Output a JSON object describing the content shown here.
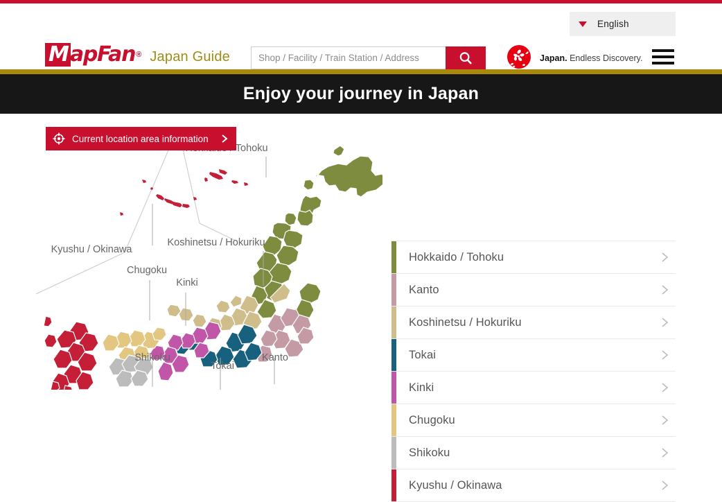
{
  "top_accent_color": "#c8102e",
  "language": {
    "label": "English",
    "caret_icon": "chevron-down-icon"
  },
  "header": {
    "logo_box_text": "M",
    "logo_rest_text": "apFan",
    "logo_tm": "®",
    "logo_subtitle": "Japan Guide",
    "search": {
      "placeholder": "Shop / Facility / Train Station / Address",
      "value": "",
      "button_icon": "search-icon",
      "button_color": "#c8102e"
    },
    "partner_logo": {
      "bold_text": "Japan.",
      "text": " Endless Discovery.",
      "icon": "cherry-blossom-circle-icon"
    },
    "menu_icon": "hamburger-menu-icon"
  },
  "banner": {
    "title": "Enjoy your journey in Japan",
    "background": "#171717",
    "rule_color": "#a8890b"
  },
  "current_location_button": {
    "label": "Current location area information",
    "icon": "crosshair-location-icon",
    "chevron": "chevron-right-icon",
    "color": "#c8102e"
  },
  "regions": [
    {
      "label": "Hokkaido / Tohoku",
      "color": "#7d8c3e",
      "map_label": "Hokkaido / Tohoku"
    },
    {
      "label": "Kanto",
      "color": "#c49aa5",
      "map_label": "Kanto"
    },
    {
      "label": "Koshinetsu / Hokuriku",
      "color": "#cfbd8c",
      "map_label": "Koshinetsu / Hokuriku"
    },
    {
      "label": "Tokai",
      "color": "#17617f",
      "map_label": "Tokai"
    },
    {
      "label": "Kinki",
      "color": "#c156a8",
      "map_label": "Kinki"
    },
    {
      "label": "Chugoku",
      "color": "#e3c67f",
      "map_label": "Chugoku"
    },
    {
      "label": "Shikoku",
      "color": "#bcbcbc",
      "map_label": "Shikoku"
    },
    {
      "label": "Kyushu / Okinawa",
      "color": "#c41f37",
      "map_label": "Kyushu / Okinawa"
    }
  ],
  "map": {
    "labels": [
      "Hokkaido / Tohoku",
      "Koshinetsu / Hokuriku",
      "Kyushu / Okinawa",
      "Chugoku",
      "Kinki",
      "Shikoku",
      "Tokai",
      "Kanto"
    ],
    "label_color": "#666666"
  }
}
